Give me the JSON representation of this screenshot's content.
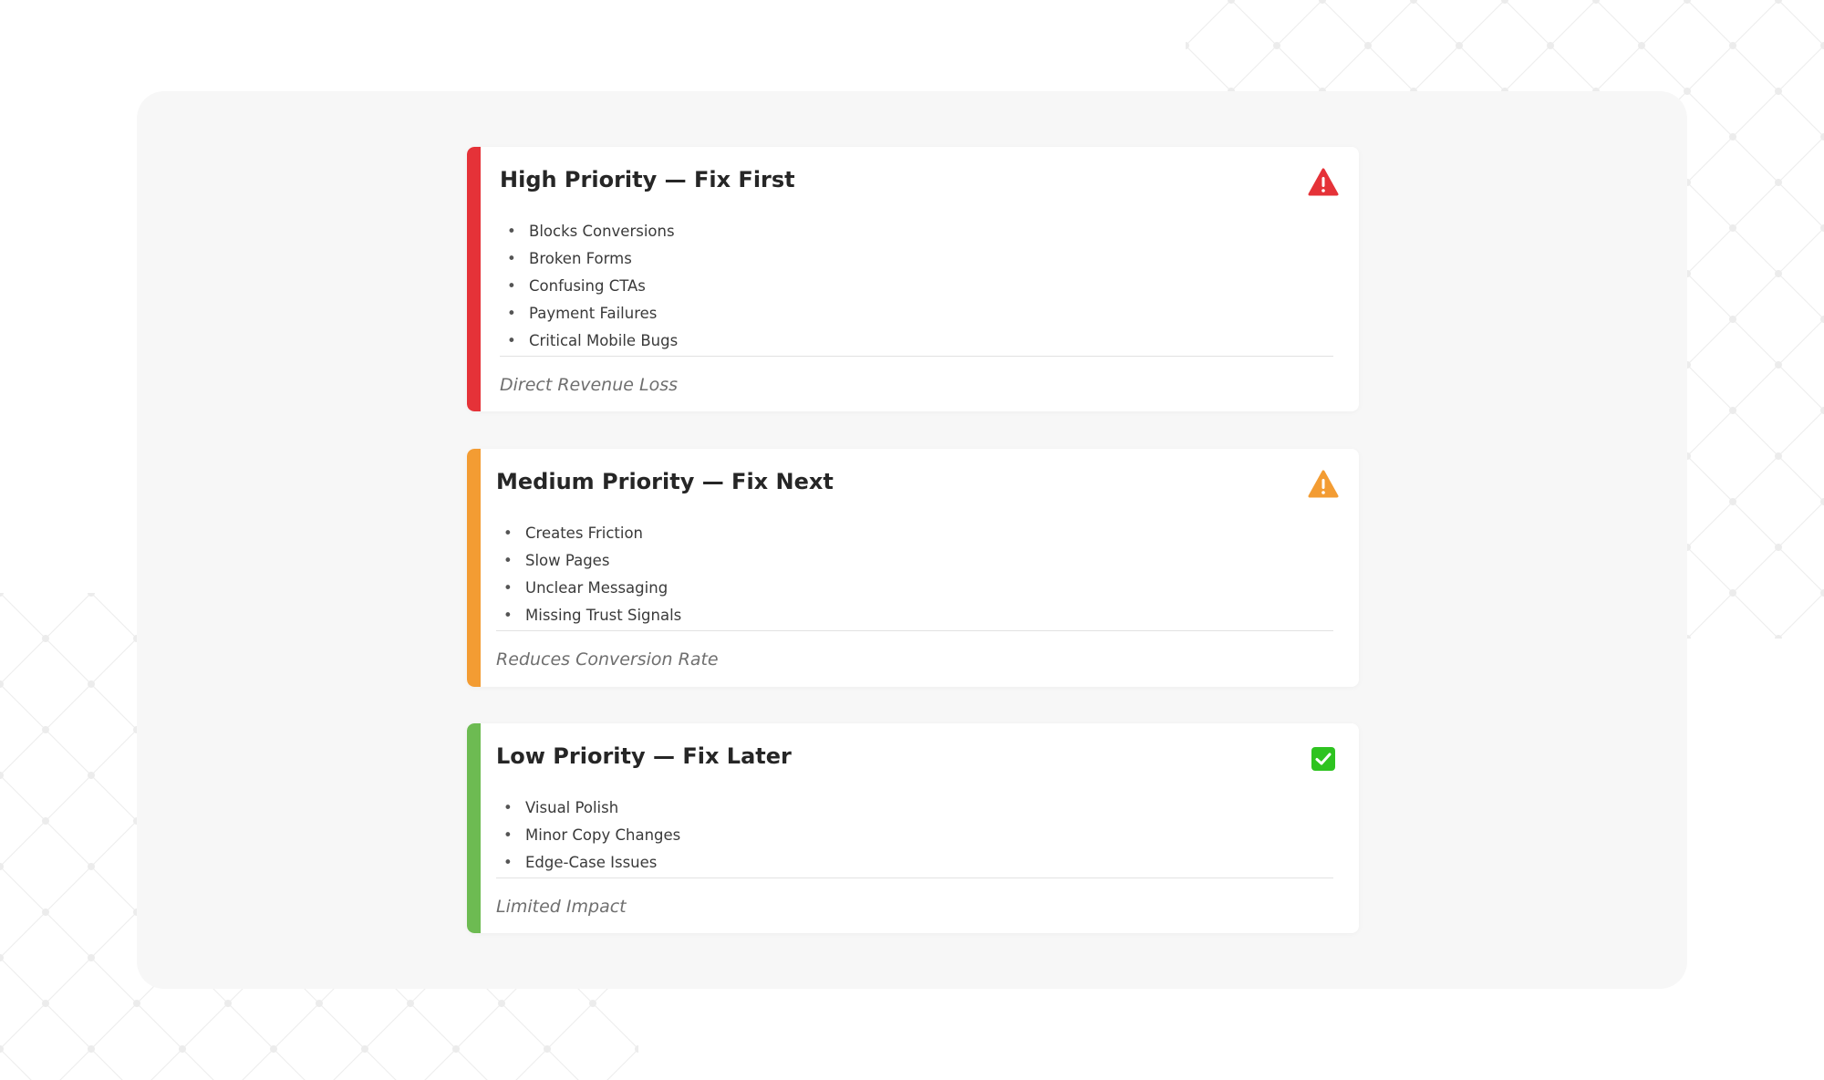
{
  "cards": [
    {
      "title": "High Priority — Fix First",
      "icon": "warning-triangle-icon",
      "color": "#e53238",
      "items": [
        "Blocks Conversions",
        "Broken Forms",
        "Confusing CTAs",
        "Payment Failures",
        "Critical Mobile Bugs"
      ],
      "footer": "Direct Revenue Loss"
    },
    {
      "title": "Medium Priority — Fix Next",
      "icon": "warning-triangle-icon",
      "color": "#f39c33",
      "items": [
        "Creates Friction",
        "Slow Pages",
        "Unclear Messaging",
        "Missing Trust Signals"
      ],
      "footer": "Reduces Conversion Rate"
    },
    {
      "title": "Low Priority — Fix Later",
      "icon": "check-square-icon",
      "color": "#6dbb52",
      "icon_color": "#2ec320",
      "items": [
        "Visual Polish",
        "Minor Copy Changes",
        "Edge-Case Issues"
      ],
      "footer": "Limited Impact"
    }
  ]
}
